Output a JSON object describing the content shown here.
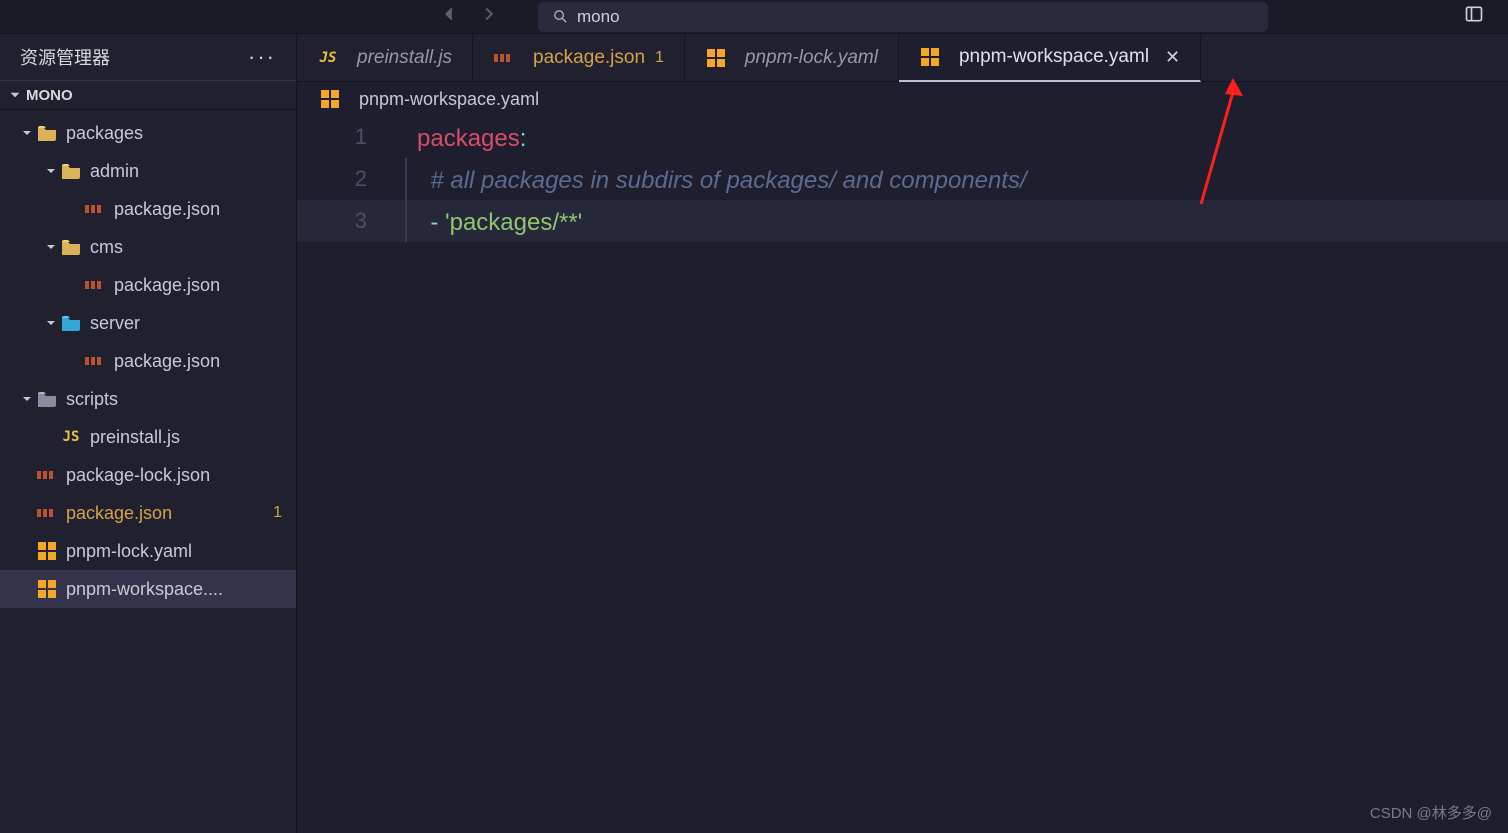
{
  "titlebar": {
    "search_text": "mono"
  },
  "sidebar": {
    "title": "资源管理器",
    "section": "MONO"
  },
  "tree": [
    {
      "name": "packages",
      "type": "folder-open",
      "depth": 0,
      "expand": "down"
    },
    {
      "name": "admin",
      "type": "folder-open",
      "depth": 1,
      "expand": "down"
    },
    {
      "name": "package.json",
      "type": "json",
      "depth": 2
    },
    {
      "name": "cms",
      "type": "folder-open",
      "depth": 1,
      "expand": "down"
    },
    {
      "name": "package.json",
      "type": "json",
      "depth": 2
    },
    {
      "name": "server",
      "type": "folder-blue",
      "depth": 1,
      "expand": "down"
    },
    {
      "name": "package.json",
      "type": "json",
      "depth": 2
    },
    {
      "name": "scripts",
      "type": "folder-script",
      "depth": 0,
      "expand": "down"
    },
    {
      "name": "preinstall.js",
      "type": "js",
      "depth": 1
    },
    {
      "name": "package-lock.json",
      "type": "json",
      "depth": 0
    },
    {
      "name": "package.json",
      "type": "json",
      "depth": 0,
      "badge": "1",
      "mod": true
    },
    {
      "name": "pnpm-lock.yaml",
      "type": "yaml",
      "depth": 0
    },
    {
      "name": "pnpm-workspace....",
      "type": "yaml",
      "depth": 0,
      "selected": true
    }
  ],
  "tabs": [
    {
      "label": "preinstall.js",
      "type": "js",
      "italic": true
    },
    {
      "label": "package.json",
      "type": "json",
      "badge": "1",
      "mod": true
    },
    {
      "label": "pnpm-lock.yaml",
      "type": "yaml",
      "italic": true
    },
    {
      "label": "pnpm-workspace.yaml",
      "type": "yaml",
      "active": true,
      "close": true
    }
  ],
  "breadcrumb": {
    "file": "pnpm-workspace.yaml"
  },
  "code": {
    "lines": [
      "1",
      "2",
      "3"
    ],
    "l1_key": "packages",
    "l1_colon": ":",
    "l2_comment": "# all packages in subdirs of packages/ and components/",
    "l3_dash": "- ",
    "l3_string": "'packages/**'"
  },
  "watermark": "CSDN @林多多@"
}
